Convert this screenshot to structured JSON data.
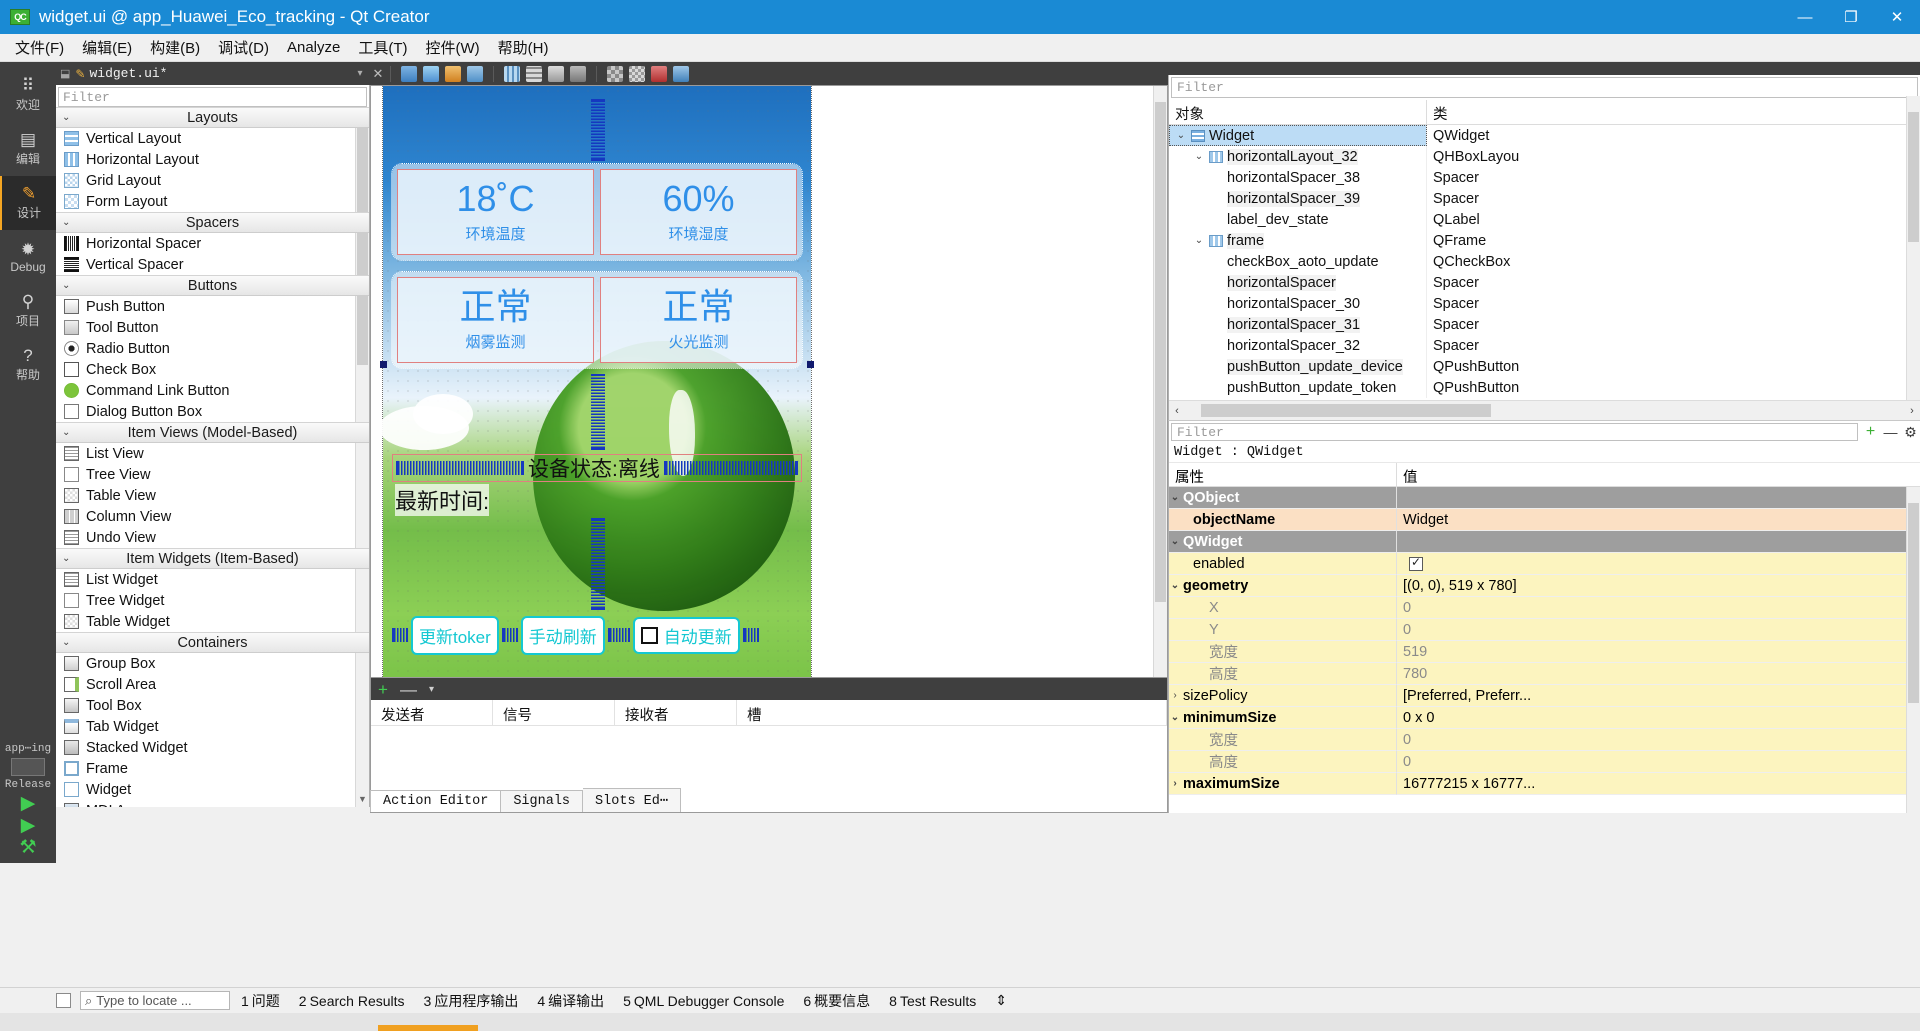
{
  "window": {
    "title": "widget.ui @ app_Huawei_Eco_tracking - Qt Creator",
    "logo": "QC",
    "minimize": "—",
    "maximize": "❐",
    "close": "✕"
  },
  "menubar": [
    {
      "label": "文件(F)"
    },
    {
      "label": "编辑(E)"
    },
    {
      "label": "构建(B)"
    },
    {
      "label": "调试(D)"
    },
    {
      "label": "Analyze"
    },
    {
      "label": "工具(T)"
    },
    {
      "label": "控件(W)"
    },
    {
      "label": "帮助(H)"
    }
  ],
  "modebar": {
    "items": [
      {
        "label": "欢迎",
        "icon": "grid-icon",
        "glyph": "⠿"
      },
      {
        "label": "编辑",
        "icon": "document-icon",
        "glyph": "▤"
      },
      {
        "label": "设计",
        "icon": "pencil-icon",
        "glyph": "✎"
      },
      {
        "label": "Debug",
        "icon": "bug-icon",
        "glyph": "✹"
      },
      {
        "label": "项目",
        "icon": "wrench-icon",
        "glyph": "⚲"
      },
      {
        "label": "帮助",
        "icon": "help-icon",
        "glyph": "?"
      }
    ],
    "active": "设计",
    "kit_label": "app⋯ing",
    "run_config": "Release",
    "run": "▶",
    "debug_run": "▶",
    "build": "⚒"
  },
  "tabstrip": {
    "filename": "widget.ui*",
    "pencil": "✎",
    "dropdown": "▾",
    "close": "✕"
  },
  "widgetbox": {
    "filter_placeholder": "Filter",
    "groups": [
      {
        "name": "Layouts",
        "items": [
          {
            "label": "Vertical Layout",
            "icon": "vertical-layout-icon"
          },
          {
            "label": "Horizontal Layout",
            "icon": "horizontal-layout-icon"
          },
          {
            "label": "Grid Layout",
            "icon": "grid-layout-icon"
          },
          {
            "label": "Form Layout",
            "icon": "form-layout-icon"
          }
        ]
      },
      {
        "name": "Spacers",
        "items": [
          {
            "label": "Horizontal Spacer",
            "icon": "horizontal-spacer-icon"
          },
          {
            "label": "Vertical Spacer",
            "icon": "vertical-spacer-icon"
          }
        ]
      },
      {
        "name": "Buttons",
        "items": [
          {
            "label": "Push Button",
            "icon": "push-button-icon"
          },
          {
            "label": "Tool Button",
            "icon": "tool-button-icon"
          },
          {
            "label": "Radio Button",
            "icon": "radio-button-icon"
          },
          {
            "label": "Check Box",
            "icon": "check-box-icon"
          },
          {
            "label": "Command Link Button",
            "icon": "command-link-icon"
          },
          {
            "label": "Dialog Button Box",
            "icon": "dialog-button-box-icon"
          }
        ]
      },
      {
        "name": "Item Views (Model-Based)",
        "items": [
          {
            "label": "List View",
            "icon": "list-view-icon"
          },
          {
            "label": "Tree View",
            "icon": "tree-view-icon"
          },
          {
            "label": "Table View",
            "icon": "table-view-icon"
          },
          {
            "label": "Column View",
            "icon": "column-view-icon"
          },
          {
            "label": "Undo View",
            "icon": "undo-view-icon"
          }
        ]
      },
      {
        "name": "Item Widgets (Item-Based)",
        "items": [
          {
            "label": "List Widget",
            "icon": "list-widget-icon"
          },
          {
            "label": "Tree Widget",
            "icon": "tree-widget-icon"
          },
          {
            "label": "Table Widget",
            "icon": "table-widget-icon"
          }
        ]
      },
      {
        "name": "Containers",
        "items": [
          {
            "label": "Group Box",
            "icon": "group-box-icon"
          },
          {
            "label": "Scroll Area",
            "icon": "scroll-area-icon"
          },
          {
            "label": "Tool Box",
            "icon": "tool-box-icon"
          },
          {
            "label": "Tab Widget",
            "icon": "tab-widget-icon"
          },
          {
            "label": "Stacked Widget",
            "icon": "stacked-widget-icon"
          },
          {
            "label": "Frame",
            "icon": "frame-icon"
          },
          {
            "label": "Widget",
            "icon": "widget-icon"
          },
          {
            "label": "MDI Area",
            "icon": "mdi-area-icon"
          }
        ]
      }
    ]
  },
  "canvas": {
    "cards": [
      {
        "value": "18˚C",
        "label": "环境温度"
      },
      {
        "value": "60%",
        "label": "环境湿度"
      },
      {
        "value": "正常",
        "label": "烟雾监测"
      },
      {
        "value": "正常",
        "label": "火光监测"
      }
    ],
    "device_state": "设备状态:离线",
    "latest_time": "最新时间:",
    "buttons": [
      {
        "label": "更新toker"
      },
      {
        "label": "手动刷新"
      }
    ],
    "checkbox": {
      "label": "自动更新",
      "checked": false
    }
  },
  "signal_slot_editor": {
    "add": "+",
    "remove": "—",
    "more": "▾",
    "columns": [
      "发送者",
      "信号",
      "接收者",
      "槽"
    ],
    "rows": []
  },
  "editor_tabs": [
    {
      "label": "Action Editor",
      "active": true
    },
    {
      "label": "Signals",
      "active": false
    },
    {
      "label": "Slots Ed⋯",
      "active": false
    }
  ],
  "object_inspector": {
    "filter_placeholder": "Filter",
    "headers": [
      "对象",
      "类"
    ],
    "rows": [
      {
        "name": "Widget",
        "class": "QWidget",
        "depth": 0,
        "expandable": true,
        "expanded": true,
        "icon": "widget-icon",
        "selected": true
      },
      {
        "name": "horizontalLayout_32",
        "class": "QHBoxLayou",
        "depth": 1,
        "expandable": true,
        "expanded": true,
        "icon": "hlayout-icon",
        "selected": false
      },
      {
        "name": "horizontalSpacer_38",
        "class": "Spacer",
        "depth": 2,
        "expandable": false,
        "expanded": false,
        "icon": "",
        "selected": false
      },
      {
        "name": "horizontalSpacer_39",
        "class": "Spacer",
        "depth": 2,
        "expandable": false,
        "expanded": false,
        "icon": "",
        "selected": false
      },
      {
        "name": "label_dev_state",
        "class": "QLabel",
        "depth": 2,
        "expandable": false,
        "expanded": false,
        "icon": "",
        "selected": false
      },
      {
        "name": "frame",
        "class": "QFrame",
        "depth": 1,
        "expandable": true,
        "expanded": true,
        "icon": "hlayout-icon",
        "selected": false
      },
      {
        "name": "checkBox_aoto_update",
        "class": "QCheckBox",
        "depth": 2,
        "expandable": false,
        "expanded": false,
        "icon": "",
        "selected": false
      },
      {
        "name": "horizontalSpacer",
        "class": "Spacer",
        "depth": 2,
        "expandable": false,
        "expanded": false,
        "icon": "",
        "selected": false
      },
      {
        "name": "horizontalSpacer_30",
        "class": "Spacer",
        "depth": 2,
        "expandable": false,
        "expanded": false,
        "icon": "",
        "selected": false
      },
      {
        "name": "horizontalSpacer_31",
        "class": "Spacer",
        "depth": 2,
        "expandable": false,
        "expanded": false,
        "icon": "",
        "selected": false
      },
      {
        "name": "horizontalSpacer_32",
        "class": "Spacer",
        "depth": 2,
        "expandable": false,
        "expanded": false,
        "icon": "",
        "selected": false
      },
      {
        "name": "pushButton_update_device",
        "class": "QPushButton",
        "depth": 2,
        "expandable": false,
        "expanded": false,
        "icon": "",
        "selected": false
      },
      {
        "name": "pushButton_update_token",
        "class": "QPushButton",
        "depth": 2,
        "expandable": false,
        "expanded": false,
        "icon": "",
        "selected": false
      }
    ]
  },
  "property_editor": {
    "filter_placeholder": "Filter",
    "add_icon": "+",
    "remove_icon": "—",
    "config_icon": "⚙",
    "object_line": "Widget : QWidget",
    "headers": [
      "属性",
      "值"
    ],
    "rows": [
      {
        "key": "QObject",
        "value": "",
        "kind": "group",
        "indent": 0,
        "expandable": true,
        "expanded": true
      },
      {
        "key": "objectName",
        "value": "Widget",
        "kind": "peach",
        "indent": 1,
        "expandable": false,
        "expanded": false
      },
      {
        "key": "QWidget",
        "value": "",
        "kind": "group",
        "indent": 0,
        "expandable": true,
        "expanded": true
      },
      {
        "key": "enabled",
        "value": "",
        "kind": "yellow-check",
        "indent": 1,
        "expandable": false,
        "expanded": false
      },
      {
        "key": "geometry",
        "value": "[(0, 0), 519 x 780]",
        "kind": "yellow-bold",
        "indent": 0,
        "expandable": true,
        "expanded": true
      },
      {
        "key": "X",
        "value": "0",
        "kind": "yellow-sub",
        "indent": 2,
        "expandable": false,
        "expanded": false
      },
      {
        "key": "Y",
        "value": "0",
        "kind": "yellow-sub",
        "indent": 2,
        "expandable": false,
        "expanded": false
      },
      {
        "key": "宽度",
        "value": "519",
        "kind": "yellow-sub",
        "indent": 2,
        "expandable": false,
        "expanded": false
      },
      {
        "key": "高度",
        "value": "780",
        "kind": "yellow-sub",
        "indent": 2,
        "expandable": false,
        "expanded": false
      },
      {
        "key": "sizePolicy",
        "value": "[Preferred, Preferr...",
        "kind": "yellow",
        "indent": 0,
        "expandable": true,
        "expanded": false
      },
      {
        "key": "minimumSize",
        "value": "0 x 0",
        "kind": "yellow-bold",
        "indent": 0,
        "expandable": true,
        "expanded": true
      },
      {
        "key": "宽度",
        "value": "0",
        "kind": "yellow-sub",
        "indent": 2,
        "expandable": false,
        "expanded": false
      },
      {
        "key": "高度",
        "value": "0",
        "kind": "yellow-sub",
        "indent": 2,
        "expandable": false,
        "expanded": false
      },
      {
        "key": "maximumSize",
        "value": "16777215 x 16777...",
        "kind": "yellow-bold",
        "indent": 0,
        "expandable": true,
        "expanded": false
      }
    ]
  },
  "statusbar": {
    "locate_placeholder": "Type to locate ...",
    "search_icon": "⌕",
    "items": [
      {
        "num": "1",
        "label": "问题"
      },
      {
        "num": "2",
        "label": "Search Results"
      },
      {
        "num": "3",
        "label": "应用程序输出"
      },
      {
        "num": "4",
        "label": "编译输出"
      },
      {
        "num": "5",
        "label": "QML Debugger Console"
      },
      {
        "num": "6",
        "label": "概要信息"
      },
      {
        "num": "8",
        "label": "Test Results"
      }
    ],
    "updown": "⇕"
  }
}
